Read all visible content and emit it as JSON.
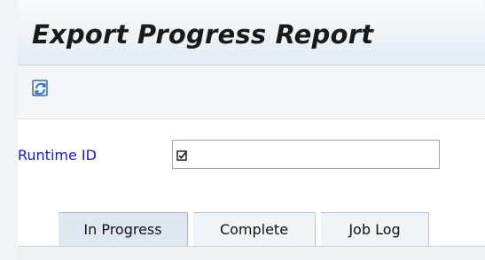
{
  "window": {
    "title": "Export Progress Report"
  },
  "toolbar": {
    "refresh_icon": "refresh-icon"
  },
  "form": {
    "runtime_id_label": "Runtime ID",
    "runtime_id_value": "",
    "runtime_id_icon": "checkbox-icon"
  },
  "tabs": [
    {
      "label": "In Progress",
      "active": true
    },
    {
      "label": "Complete",
      "active": false
    },
    {
      "label": "Job Log",
      "active": false
    }
  ],
  "colors": {
    "label_blue": "#1b1bb8",
    "header_background": "#e3ecf3",
    "active_tab": "#dfe8f0",
    "inactive_tab": "#eef3f7"
  }
}
